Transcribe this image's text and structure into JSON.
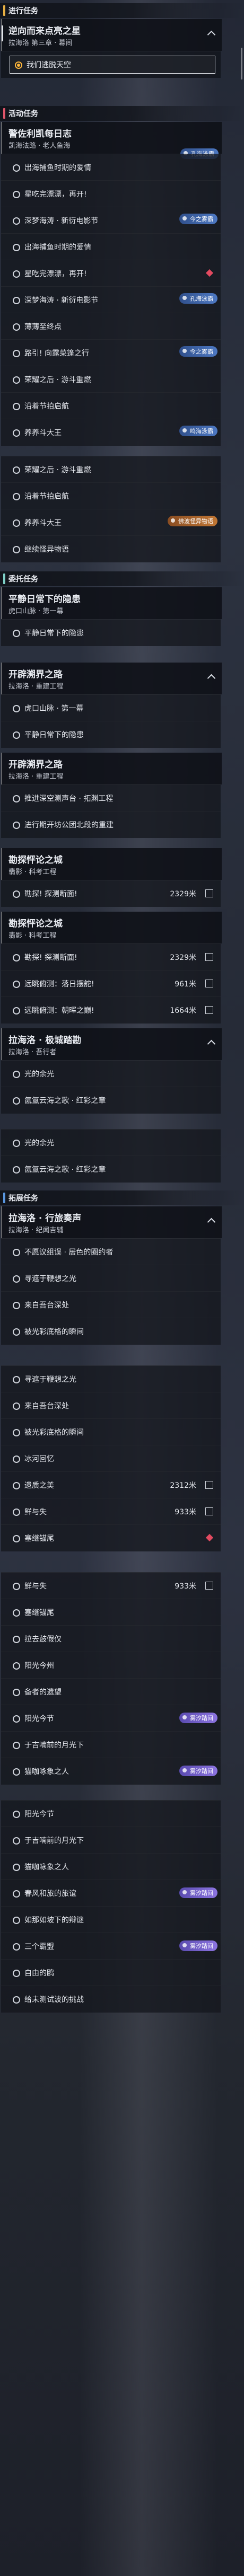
{
  "colors": {
    "sec_ongoing": "#e8b043",
    "sec_active": "#e0556a",
    "sec_daily": "#7fd1c8",
    "sec_explore": "#5a97e0"
  },
  "sections": {
    "ongoing": "进行任务",
    "active": "活动任务",
    "daily": "委托任务",
    "explore": "拓展任务"
  },
  "quests": [
    {
      "title": "逆向而来点亮之星",
      "sub": "拉海洛 第三章 · 幕间"
    },
    {
      "title": "警佐利凯每日志",
      "sub": "凯海法路 · 老人鱼海"
    },
    {
      "title": "平静日常下的隐患",
      "sub": "虎口山脉 · 第一幕"
    },
    {
      "title": "开辟溯界之路",
      "sub": "拉海洛 · 重建工程"
    },
    {
      "title": "开辟溯界之路",
      "sub": "拉海洛 · 重建工程"
    },
    {
      "title": "勘探怦论之城",
      "sub": "翡影 · 科考工程"
    },
    {
      "title": "勘探怦论之城",
      "sub": "翡影 · 科考工程"
    },
    {
      "title": "拉海洛 · 极城踏勘",
      "sub": "拉海洛 · 吾行者"
    },
    {
      "title": "拉海洛 · 行旅奏声",
      "sub": "拉海洛 · 纪闻吉辅"
    }
  ],
  "rows": [
    {
      "label": "我们逃脱天空",
      "dist": "",
      "tag": ""
    },
    {
      "label": "出海捕鱼时期的爱情",
      "dist": "",
      "tag": ""
    },
    {
      "label": "星吃完漂漂，再开!",
      "dist": "",
      "tag": ""
    },
    {
      "label": "深梦海涛 · 新衍电影节",
      "dist": "",
      "tag": ""
    },
    {
      "label": "出海捕鱼时期的爱情",
      "dist": "",
      "tag": ""
    },
    {
      "label": "星吃完漂漂，再开!",
      "dist": "",
      "tag": ""
    },
    {
      "label": "深梦海涛 · 新衍电影节",
      "dist": "",
      "tag": ""
    },
    {
      "label": "薄薄至终点",
      "dist": "",
      "tag": ""
    },
    {
      "label": "路引! 向露菜篷之行",
      "dist": "",
      "tag": ""
    },
    {
      "label": "荣耀之后 · 游斗重燃",
      "dist": "",
      "tag": ""
    },
    {
      "label": "沿着节拍启航",
      "dist": "",
      "tag": ""
    },
    {
      "label": "养养斗大王",
      "dist": "",
      "tag": ""
    },
    {
      "label": "荣耀之后 · 游斗重燃",
      "dist": "",
      "tag": ""
    },
    {
      "label": "沿着节拍启航",
      "dist": "",
      "tag": ""
    },
    {
      "label": "养养斗大王",
      "dist": "",
      "tag": ""
    },
    {
      "label": "继续怪异物语",
      "dist": "",
      "tag": ""
    },
    {
      "label": "平静日常下的隐患",
      "dist": "",
      "tag": ""
    },
    {
      "label": "虎口山脉 · 第一幕",
      "dist": "",
      "tag": ""
    },
    {
      "label": "平静日常下的隐患",
      "dist": "",
      "tag": ""
    },
    {
      "label": "推进深空测声台 · 拓渊工程",
      "dist": "",
      "tag": ""
    },
    {
      "label": "进行期开坊公团北段的重建",
      "dist": "",
      "tag": ""
    },
    {
      "label": "勘探! 探测断面!",
      "dist": "2329米",
      "tag": ""
    },
    {
      "label": "勘探! 探测断面!",
      "dist": "2329米",
      "tag": ""
    },
    {
      "label": "远眺俯测：落日摆舵!",
      "dist": "961米",
      "tag": ""
    },
    {
      "label": "远眺俯测：朝晖之巅!",
      "dist": "1664米",
      "tag": ""
    },
    {
      "label": "光的余光",
      "dist": "",
      "tag": ""
    },
    {
      "label": "氤氲云海之歌 · 红彩之章",
      "dist": "",
      "tag": ""
    },
    {
      "label": "光的余光",
      "dist": "",
      "tag": ""
    },
    {
      "label": "氤氲云海之歌 · 红彩之章",
      "dist": "",
      "tag": ""
    },
    {
      "label": "不愿议组误 · 居色的圈约者",
      "dist": "",
      "tag": ""
    },
    {
      "label": "寻遮于鞭想之光",
      "dist": "",
      "tag": ""
    },
    {
      "label": "来自吾台深处",
      "dist": "",
      "tag": ""
    },
    {
      "label": "被光彩底格的瞬间",
      "dist": "",
      "tag": ""
    },
    {
      "label": "寻遮于鞭想之光",
      "dist": "",
      "tag": ""
    },
    {
      "label": "来自吾台深处",
      "dist": "",
      "tag": ""
    },
    {
      "label": "被光彩底格的瞬间",
      "dist": "",
      "tag": ""
    },
    {
      "label": "冰河回忆",
      "dist": "",
      "tag": ""
    },
    {
      "label": "遗质之美",
      "dist": "2312米",
      "tag": ""
    },
    {
      "label": "鲜与失",
      "dist": "933米",
      "tag": ""
    },
    {
      "label": "塞继锚尾",
      "dist": "",
      "tag": ""
    },
    {
      "label": "鲜与失",
      "dist": "933米",
      "tag": ""
    },
    {
      "label": "塞继锚尾",
      "dist": "",
      "tag": ""
    },
    {
      "label": "拉去鼓假仅",
      "dist": "",
      "tag": ""
    },
    {
      "label": "阳光今州",
      "dist": "",
      "tag": ""
    },
    {
      "label": "备者的遗望",
      "dist": "",
      "tag": ""
    },
    {
      "label": "阳光今节",
      "dist": "",
      "tag": ""
    },
    {
      "label": "于吉喃前的月光下",
      "dist": "",
      "tag": ""
    },
    {
      "label": "猫咖咏象之人",
      "dist": "",
      "tag": ""
    },
    {
      "label": "阳光今节",
      "dist": "",
      "tag": ""
    },
    {
      "label": "于吉喃前的月光下",
      "dist": "",
      "tag": ""
    },
    {
      "label": "猫咖咏象之人",
      "dist": "",
      "tag": ""
    },
    {
      "label": "春风和旅的旅谊",
      "dist": "",
      "tag": ""
    },
    {
      "label": "如那如坡下的辩谜",
      "dist": "",
      "tag": ""
    },
    {
      "label": "三个霸盟",
      "dist": "",
      "tag": ""
    },
    {
      "label": "自由的鸥",
      "dist": "",
      "tag": ""
    },
    {
      "label": "给未测试波的挑战",
      "dist": "",
      "tag": ""
    }
  ],
  "badges": {
    "b1": "孔海泳霸",
    "b2": "今之雾霸",
    "b3": "孔海泳霸",
    "b4": "今之雾霸",
    "b5": "鸣海泳霸",
    "b6": "佛波怪异物语",
    "p1": "雾汐踏间",
    "p2": "雾汐踏间",
    "p3": "雾汐踏间",
    "p4": "雾汐踏间"
  }
}
